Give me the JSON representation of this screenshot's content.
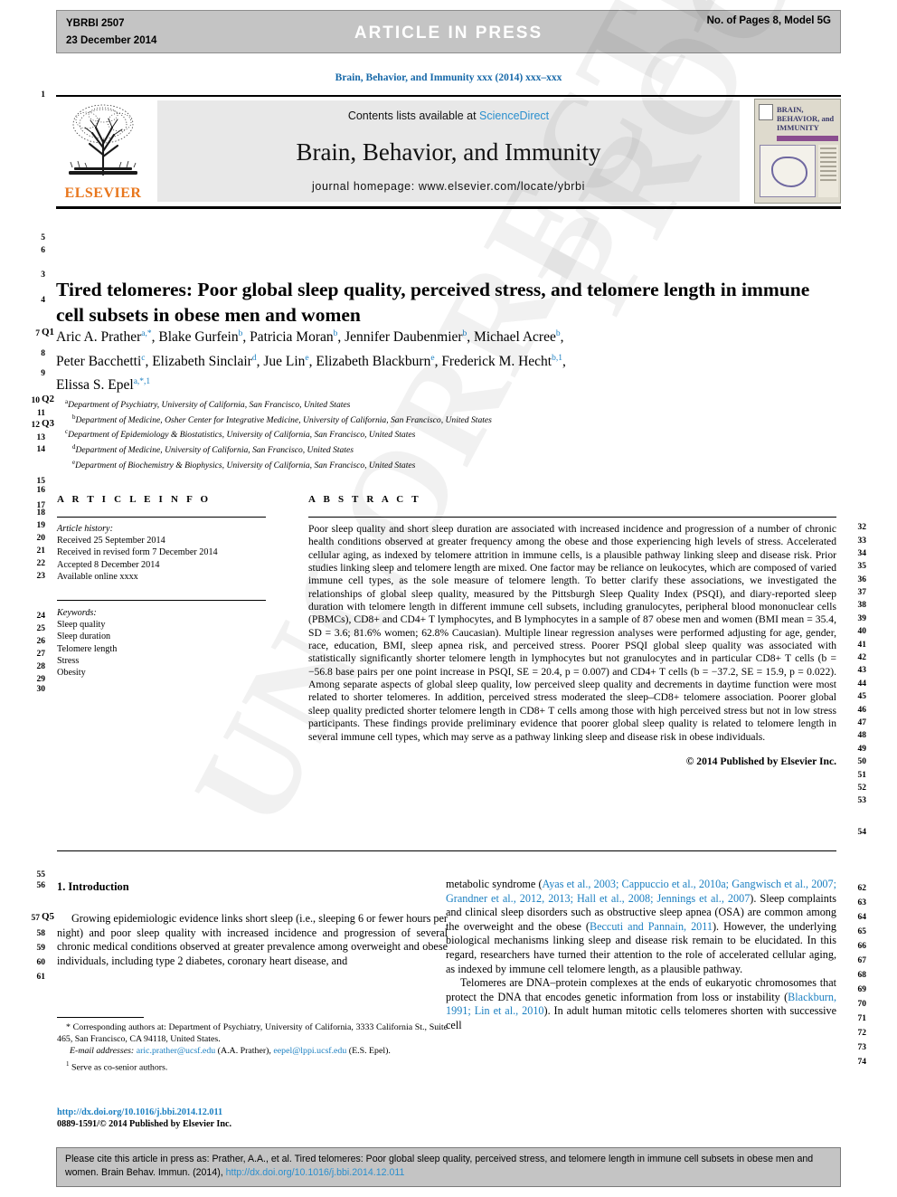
{
  "header": {
    "journal_code": "YBRBI 2507",
    "date": "23 December 2014",
    "banner": "ARTICLE  IN  PRESS",
    "pages_model": "No. of Pages 8, Model 5G"
  },
  "running_head": "Brain, Behavior, and Immunity xxx (2014) xxx–xxx",
  "masthead": {
    "contents_prefix": "Contents lists available at ",
    "sciencedirect": "ScienceDirect",
    "journal_title": "Brain, Behavior, and Immunity",
    "homepage": "journal homepage: www.elsevier.com/locate/ybrbi",
    "publisher": "ELSEVIER",
    "cover_title": "BRAIN, BEHAVIOR, and IMMUNITY"
  },
  "article": {
    "title": "Tired telomeres: Poor global sleep quality, perceived stress, and telomere length in immune cell subsets in obese men and women",
    "authors_line_1": "Aric A. Prather a,*, Blake Gurfein b, Patricia Moran b, Jennifer Daubenmier b, Michael Acree b,",
    "authors_line_2": "Peter Bacchetti c, Elizabeth Sinclair d, Jue Lin e, Elizabeth Blackburn e, Frederick M. Hecht b,1,",
    "authors_line_3": "Elissa S. Epel a,*,1",
    "affiliations": [
      {
        "mark": "a",
        "text": "Department of Psychiatry, University of California, San Francisco, United States"
      },
      {
        "mark": "b",
        "text": "Department of Medicine, Osher Center for Integrative Medicine, University of California, San Francisco, United States"
      },
      {
        "mark": "c",
        "text": "Department of Epidemiology & Biostatistics, University of California, San Francisco, United States"
      },
      {
        "mark": "d",
        "text": "Department of Medicine, University of California, San Francisco, United States"
      },
      {
        "mark": "e",
        "text": "Department of Biochemistry & Biophysics, University of California, San Francisco, United States"
      }
    ]
  },
  "article_info": {
    "heading": "A R T I C L E    I N F O",
    "history_label": "Article history:",
    "history": [
      "Received 25 September 2014",
      "Received in revised form 7 December 2014",
      "Accepted 8 December 2014",
      "Available online xxxx"
    ],
    "keywords_label": "Keywords:",
    "keywords": [
      "Sleep quality",
      "Sleep duration",
      "Telomere length",
      "Stress",
      "Obesity"
    ]
  },
  "abstract": {
    "heading": "A B S T R A C T",
    "text": "Poor sleep quality and short sleep duration are associated with increased incidence and progression of a number of chronic health conditions observed at greater frequency among the obese and those experiencing high levels of stress. Accelerated cellular aging, as indexed by telomere attrition in immune cells, is a plausible pathway linking sleep and disease risk. Prior studies linking sleep and telomere length are mixed. One factor may be reliance on leukocytes, which are composed of varied immune cell types, as the sole measure of telomere length. To better clarify these associations, we investigated the relationships of global sleep quality, measured by the Pittsburgh Sleep Quality Index (PSQI), and diary-reported sleep duration with telomere length in different immune cell subsets, including granulocytes, peripheral blood mononuclear cells (PBMCs), CD8+ and CD4+ T lymphocytes, and B lymphocytes in a sample of 87 obese men and women (BMI mean = 35.4, SD = 3.6; 81.6% women; 62.8% Caucasian). Multiple linear regression analyses were performed adjusting for age, gender, race, education, BMI, sleep apnea risk, and perceived stress. Poorer PSQI global sleep quality was associated with statistically significantly shorter telomere length in lymphocytes but not granulocytes and in particular CD8+ T cells (b = −56.8 base pairs per one point increase in PSQI, SE = 20.4, p = 0.007) and CD4+ T cells (b = −37.2, SE = 15.9, p = 0.022). Among separate aspects of global sleep quality, low perceived sleep quality and decrements in daytime function were most related to shorter telomeres. In addition, perceived stress moderated the sleep–CD8+ telomere association. Poorer global sleep quality predicted shorter telomere length in CD8+ T cells among those with high perceived stress but not in low stress participants. These findings provide preliminary evidence that poorer global sleep quality is related to telomere length in several immune cell types, which may serve as a pathway linking sleep and disease risk in obese individuals.",
    "copyright": "© 2014 Published by Elsevier Inc."
  },
  "body": {
    "section_heading": "1. Introduction",
    "left_paragraph": "Growing epidemiologic evidence links short sleep (i.e., sleeping 6 or fewer hours per night) and poor sleep quality with increased incidence and progression of several chronic medical conditions observed at greater prevalence among overweight and obese individuals, including type 2 diabetes, coronary heart disease, and",
    "right_paragraph_1_a": "metabolic syndrome (",
    "right_paragraph_1_refs": "Ayas et al., 2003; Cappuccio et al., 2010a; Gangwisch et al., 2007; Grandner et al., 2012, 2013; Hall et al., 2008; Jennings et al., 2007",
    "right_paragraph_1_b": "). Sleep complaints and clinical sleep disorders such as obstructive sleep apnea (OSA) are common among the overweight and the obese (",
    "right_paragraph_1_ref2": "Beccuti and Pannain, 2011",
    "right_paragraph_1_c": "). However, the underlying biological mechanisms linking sleep and disease risk remain to be elucidated. In this regard, researchers have turned their attention to the role of accelerated cellular aging, as indexed by immune cell telomere length, as a plausible pathway.",
    "right_paragraph_2_a": "Telomeres are DNA–protein complexes at the ends of eukaryotic chromosomes that protect the DNA that encodes genetic information from loss or instability (",
    "right_paragraph_2_refs": "Blackburn, 1991; Lin et al., 2010",
    "right_paragraph_2_b": "). In adult human mitotic cells telomeres shorten with successive cell"
  },
  "footnotes": {
    "corresponding": "Corresponding authors at: Department of Psychiatry, University of California, 3333 California St., Suite 465, San Francisco, CA 94118, United States.",
    "email_label": "E-mail addresses:",
    "email_1": "aric.prather@ucsf.edu",
    "email_1_name": "(A.A. Prather),",
    "email_2": "eepel@lppi.ucsf.edu",
    "email_2_name": "(E.S. Epel).",
    "cosenior": "Serve as co-senior authors.",
    "doi_url": "http://dx.doi.org/10.1016/j.bbi.2014.12.011",
    "issn_line": "0889-1591/© 2014 Published by Elsevier Inc."
  },
  "cite_box": {
    "text_a": "Please cite this article in press as: Prather, A.A., et al. Tired telomeres: Poor global sleep quality, perceived stress, and telomere length in immune cell subsets in obese men and women. Brain Behav. Immun. (2014), ",
    "doi": "http://dx.doi.org/10.1016/j.bbi.2014.12.011"
  },
  "line_numbers": {
    "left": [
      "1",
      "5",
      "6",
      "3",
      "4",
      "7",
      "8",
      "9",
      "10",
      "11",
      "12",
      "13",
      "14",
      "15",
      "16",
      "17",
      "18",
      "19",
      "20",
      "21",
      "22",
      "23",
      "24",
      "25",
      "26",
      "27",
      "28",
      "29",
      "30",
      "55",
      "56",
      "57",
      "58",
      "59",
      "60",
      "61"
    ],
    "left_q": [
      "Q1",
      "Q2",
      "Q3",
      "Q5"
    ],
    "right": [
      "32",
      "33",
      "34",
      "35",
      "36",
      "37",
      "38",
      "39",
      "40",
      "41",
      "42",
      "43",
      "44",
      "45",
      "46",
      "47",
      "48",
      "49",
      "50",
      "51",
      "52",
      "53",
      "54",
      "62",
      "63",
      "64",
      "65",
      "66",
      "67",
      "68",
      "69",
      "70",
      "71",
      "72",
      "73",
      "74"
    ]
  },
  "watermark": {
    "text_1": "PROOF",
    "text_2": "UNCORRECTED"
  },
  "colors": {
    "link": "#1a7fc1",
    "elsevier_orange": "#e8761c",
    "grey_bar": "#c4c4c4",
    "masthead_grey": "#e8e8e8"
  }
}
